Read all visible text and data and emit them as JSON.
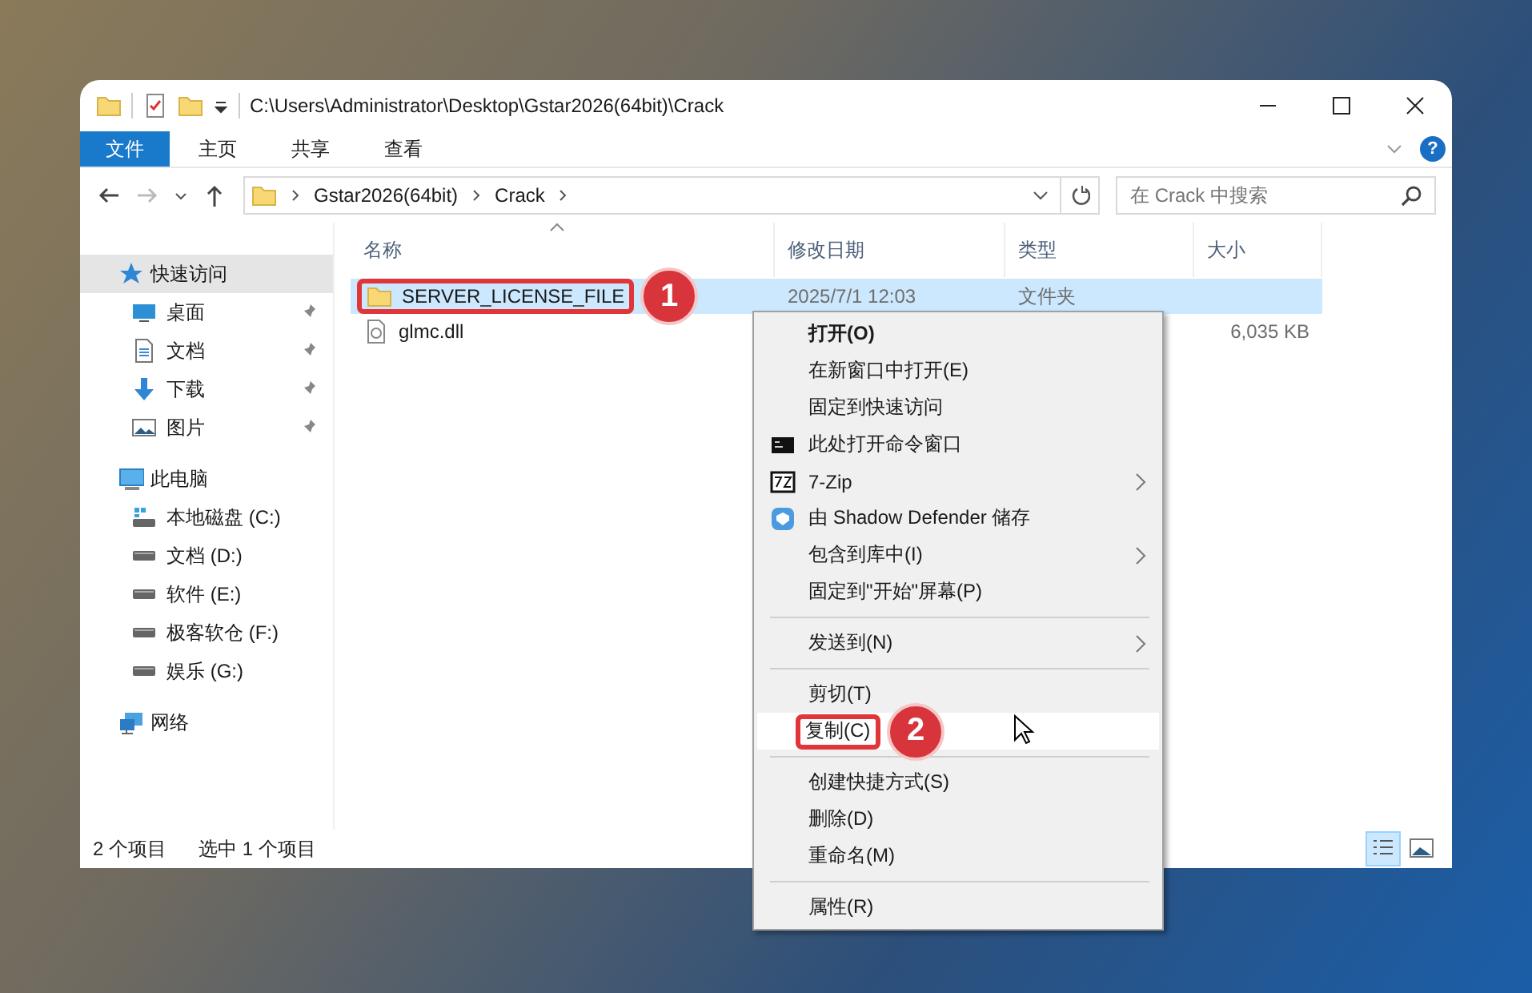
{
  "window": {
    "title": "C:\\Users\\Administrator\\Desktop\\Gstar2026(64bit)\\Crack",
    "help_button": "?"
  },
  "ribbon_tabs": [
    {
      "label": "文件",
      "selected": true
    },
    {
      "label": "主页",
      "selected": false
    },
    {
      "label": "共享",
      "selected": false
    },
    {
      "label": "查看",
      "selected": false
    }
  ],
  "breadcrumb": [
    "Gstar2026(64bit)",
    "Crack"
  ],
  "search": {
    "placeholder": "在 Crack 中搜索"
  },
  "sidebar": {
    "items": [
      {
        "label": "快速访问",
        "kind": "star",
        "selected": true,
        "children": [
          {
            "label": "桌面",
            "kind": "desktop",
            "selected": false,
            "pinned": true
          },
          {
            "label": "文档",
            "kind": "document",
            "selected": false,
            "pinned": true
          },
          {
            "label": "下载",
            "kind": "download",
            "selected": false,
            "pinned": true
          },
          {
            "label": "图片",
            "kind": "picture",
            "selected": false,
            "pinned": true
          }
        ]
      },
      {
        "label": "此电脑",
        "kind": "pc",
        "selected": false,
        "children": [
          {
            "label": "本地磁盘 (C:)",
            "kind": "system-drive",
            "selected": false
          },
          {
            "label": "文档 (D:)",
            "kind": "drive",
            "selected": false
          },
          {
            "label": "软件 (E:)",
            "kind": "drive",
            "selected": false
          },
          {
            "label": "极客软仓 (F:)",
            "kind": "drive",
            "selected": false
          },
          {
            "label": "娱乐 (G:)",
            "kind": "drive",
            "selected": false
          }
        ]
      },
      {
        "label": "网络",
        "kind": "network",
        "selected": false
      }
    ]
  },
  "table": {
    "columns": [
      {
        "label": "名称",
        "sorted": true
      },
      {
        "label": "修改日期",
        "sorted": false
      },
      {
        "label": "类型",
        "sorted": false
      },
      {
        "label": "大小",
        "sorted": false
      }
    ],
    "rows": [
      {
        "name": "SERVER_LICENSE_FILE",
        "kind": "folder",
        "modified": "2025/7/1 12:03",
        "type": "文件夹",
        "selected": true,
        "callout": "1"
      },
      {
        "name": "glmc.dll",
        "kind": "file",
        "size": "6,035 KB",
        "selected": false
      }
    ]
  },
  "context_menu": {
    "items": [
      {
        "kind": "item",
        "label": "打开(O)",
        "default": true,
        "selected": false
      },
      {
        "kind": "item",
        "label": "在新窗口中打开(E)",
        "selected": false
      },
      {
        "kind": "item",
        "label": "固定到快速访问",
        "selected": false
      },
      {
        "kind": "console",
        "label": "此处打开命令窗口",
        "selected": false
      },
      {
        "kind": "archive",
        "label": "7-Zip",
        "submenu": true,
        "selected": false
      },
      {
        "kind": "shield",
        "label": "由 Shadow Defender 储存",
        "selected": false
      },
      {
        "kind": "item",
        "label": "包含到库中(I)",
        "submenu": true,
        "selected": false
      },
      {
        "kind": "item",
        "label": "固定到\"开始\"屏幕(P)",
        "selected": false
      },
      {
        "kind": "separator"
      },
      {
        "kind": "item",
        "label": "发送到(N)",
        "submenu": true,
        "selected": false
      },
      {
        "kind": "separator"
      },
      {
        "kind": "item",
        "label": "剪切(T)",
        "selected": false
      },
      {
        "kind": "item",
        "label": "复制(C)",
        "selected": true,
        "callout": "2"
      },
      {
        "kind": "separator"
      },
      {
        "kind": "item",
        "label": "创建快捷方式(S)",
        "selected": false
      },
      {
        "kind": "item",
        "label": "删除(D)",
        "selected": false
      },
      {
        "kind": "item",
        "label": "重命名(M)",
        "selected": false
      },
      {
        "kind": "separator"
      },
      {
        "kind": "item",
        "label": "属性(R)",
        "selected": false
      }
    ]
  },
  "status_bar": {
    "item_count": "2 个项目",
    "selection": "选中 1 个项目",
    "view_buttons": [
      {
        "kind": "details",
        "selected": true
      },
      {
        "kind": "large-icons",
        "selected": false
      }
    ]
  }
}
